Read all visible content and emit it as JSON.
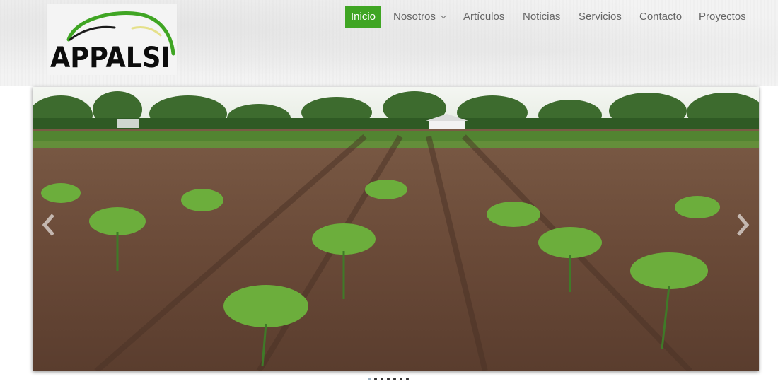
{
  "site": {
    "logo_text": "APPALSI",
    "logo_icon": "leaf-arc-logo",
    "brand_color": "#3fa523"
  },
  "nav": {
    "items": [
      {
        "label": "Inicio",
        "active": true
      },
      {
        "label": "Nosotros",
        "has_dropdown": true
      },
      {
        "label": "Artículos"
      },
      {
        "label": "Noticias"
      },
      {
        "label": "Servicios"
      },
      {
        "label": "Contacto"
      },
      {
        "label": "Proyectos"
      }
    ],
    "dropdown_icon": "chevron-down-icon"
  },
  "slider": {
    "image_subject": "cassava-field-photo",
    "prev_icon": "chevron-left-icon",
    "next_icon": "chevron-right-icon",
    "slide_count": 7,
    "active_slide": 1
  }
}
